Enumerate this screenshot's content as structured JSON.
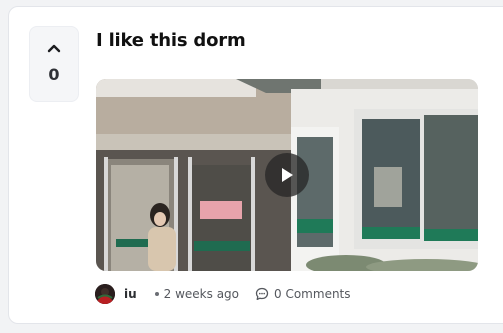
{
  "post": {
    "title": "I like this dorm",
    "vote_count": "0",
    "author": "iu",
    "time_ago": "2 weeks ago",
    "comments_label": "0 Comments"
  },
  "icons": {
    "upvote": "chevron-up-icon",
    "play": "play-icon",
    "comment": "comment-bubble-icon"
  },
  "colors": {
    "text": "#111111",
    "meta_text": "#55585e",
    "card_border": "#e3e5ea",
    "vote_bg": "#f5f6f8"
  }
}
